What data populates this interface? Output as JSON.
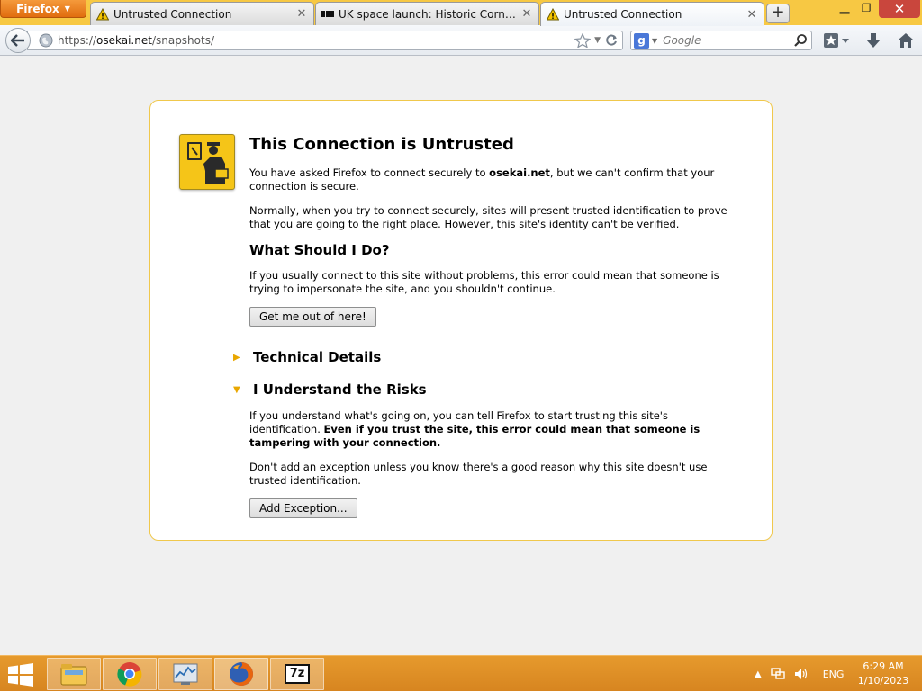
{
  "browser": {
    "menu_label": "Firefox",
    "tabs": [
      {
        "title": "Untrusted Connection",
        "icon": "warning-icon"
      },
      {
        "title": "UK space launch: Historic Cornwall ro...",
        "icon": "bbc-icon"
      },
      {
        "title": "Untrusted Connection",
        "icon": "warning-icon",
        "active": true
      }
    ],
    "new_tab_label": "+"
  },
  "navbar": {
    "url_scheme": "https://",
    "url_host": "osekai.net",
    "url_path": "/snapshots/",
    "search_engine": "Google",
    "search_placeholder": "Google"
  },
  "error_page": {
    "title": "This Connection is Untrusted",
    "intro_before": "You have asked Firefox to connect securely to ",
    "intro_host": "osekai.net",
    "intro_after": ", but we can't confirm that your connection is secure.",
    "normally": "Normally, when you try to connect securely, sites will present trusted identification to prove that you are going to the right place. However, this site's identity can't be verified.",
    "what_heading": "What Should I Do?",
    "what_text": "If you usually connect to this site without problems, this error could mean that someone is trying to impersonate the site, and you shouldn't continue.",
    "get_out_label": "Get me out of here!",
    "technical_label": "Technical Details",
    "risks_label": "I Understand the Risks",
    "risks_text_plain": "If you understand what's going on, you can tell Firefox to start trusting this site's identification. ",
    "risks_text_bold": "Even if you trust the site, this error could mean that someone is tampering with your connection.",
    "exception_text": "Don't add an exception unless you know there's a good reason why this site doesn't use trusted identification.",
    "add_exception_label": "Add Exception..."
  },
  "taskbar": {
    "apps": [
      "file-explorer-icon",
      "chrome-icon",
      "resource-monitor-icon",
      "firefox-icon",
      "7zip-icon"
    ],
    "sevenzip_label": "7z",
    "language": "ENG",
    "time": "6:29 AM",
    "date": "1/10/2023"
  },
  "colors": {
    "titlebar": "#f7c843",
    "taskbar": "#e69a2d",
    "error_border": "#f0c84c",
    "cert_icon": "#f5c518"
  }
}
